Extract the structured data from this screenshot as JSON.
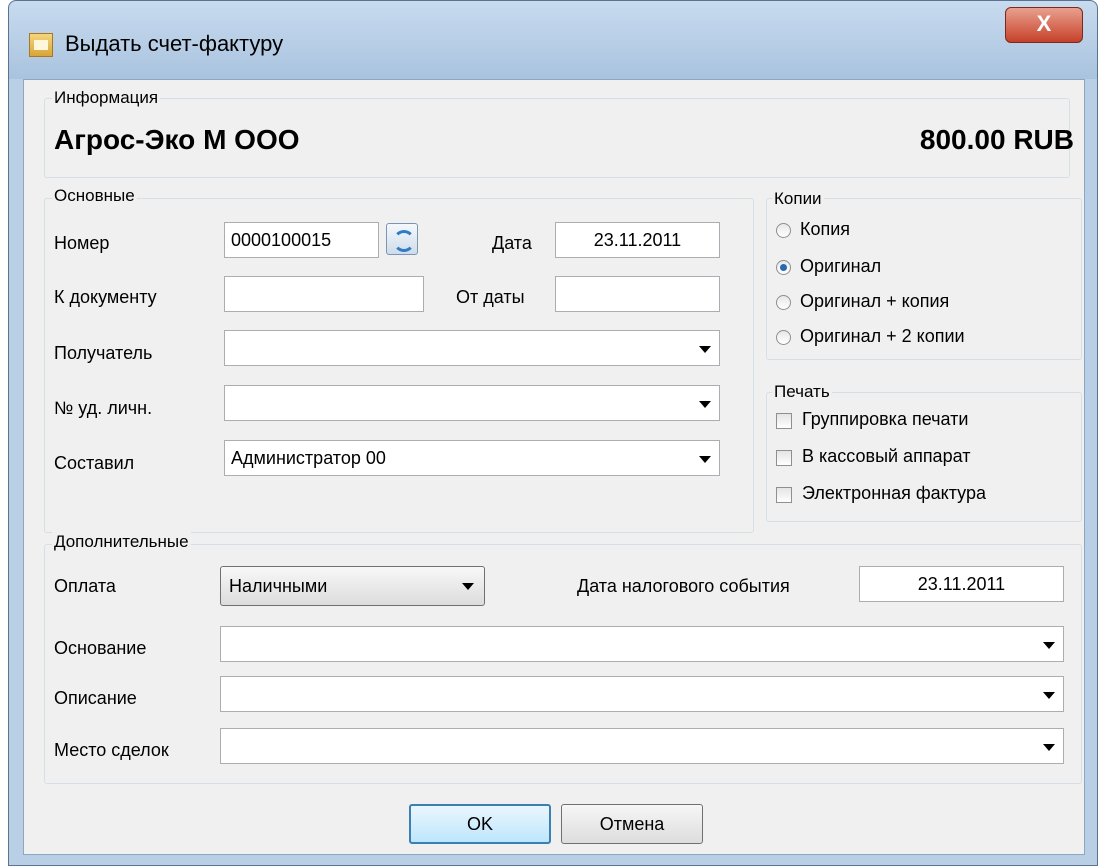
{
  "window": {
    "title": "Выдать счет-фактуру",
    "close_label": "X"
  },
  "info": {
    "legend": "Информация",
    "company": "Агрос-Эко М ООО",
    "amount": "800.00 RUB"
  },
  "main": {
    "legend": "Основные",
    "number_label": "Номер",
    "number_value": "0000100015",
    "date_label": "Дата",
    "date_value": "23.11.2011",
    "to_document_label": "К документу",
    "to_document_value": "",
    "from_date_label": "От даты",
    "from_date_value": "",
    "recipient_label": "Получатель",
    "recipient_value": "",
    "id_label": "№ уд. личн.",
    "id_value": "",
    "author_label": "Составил",
    "author_value": "Администратор 00"
  },
  "copies": {
    "legend": "Копии",
    "options": [
      "Копия",
      "Оригинал",
      "Оригинал + копия",
      "Оригинал + 2 копии"
    ],
    "selected": "Оригинал"
  },
  "print": {
    "legend": "Печать",
    "options": [
      "Группировка печати",
      "В кассовый аппарат",
      "Электронная фактура"
    ]
  },
  "additional": {
    "legend": "Дополнительные",
    "payment_label": "Оплата",
    "payment_value": "Наличными",
    "tax_date_label": "Дата налогового события",
    "tax_date_value": "23.11.2011",
    "basis_label": "Основание",
    "basis_value": "",
    "description_label": "Описание",
    "description_value": "",
    "place_label": "Место сделок",
    "place_value": ""
  },
  "buttons": {
    "ok": "OK",
    "cancel": "Отмена"
  }
}
